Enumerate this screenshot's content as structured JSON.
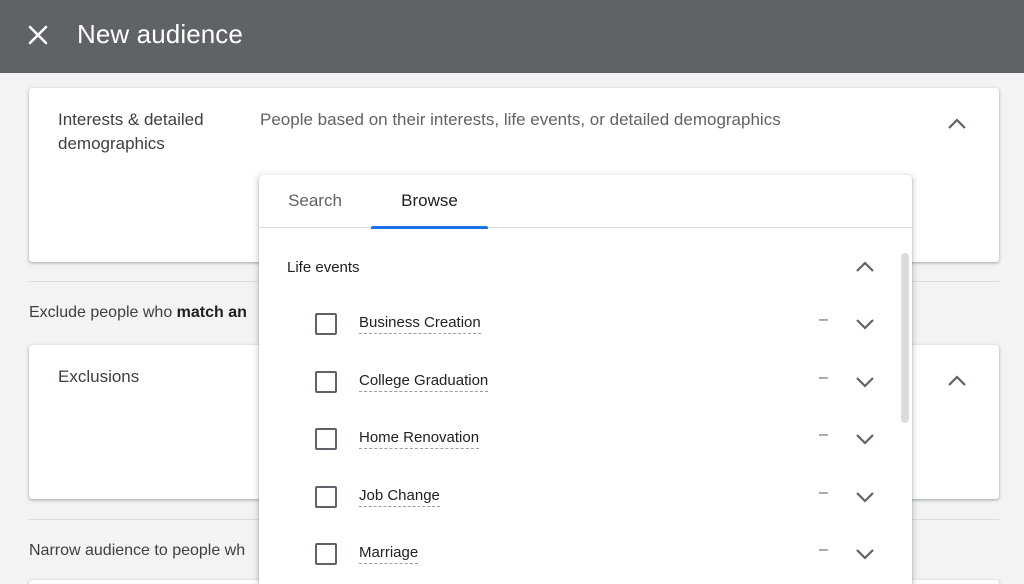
{
  "topbar": {
    "title": "New audience",
    "close_icon": "close-icon",
    "background": "#5f6368"
  },
  "interests_card": {
    "label": "Interests & detailed demographics",
    "description": "People based on their interests, life events, or detailed demographics",
    "toggle_icon": "chevron-up-icon"
  },
  "exclude_section": {
    "text_prefix": "Exclude people who ",
    "text_bold": "match an"
  },
  "exclusions_card": {
    "label": "Exclusions",
    "toggle_icon": "chevron-up-icon"
  },
  "narrow_section": {
    "text": "Narrow audience to people wh"
  },
  "popup": {
    "tabs": [
      {
        "label": "Search",
        "active": false
      },
      {
        "label": "Browse",
        "active": true
      }
    ],
    "accent": "#1a73e8",
    "group": {
      "label": "Life events",
      "toggle_icon": "chevron-up-icon",
      "items": [
        {
          "label": "Business Creation",
          "dash": "–",
          "checked": false
        },
        {
          "label": "College Graduation",
          "dash": "–",
          "checked": false
        },
        {
          "label": "Home Renovation",
          "dash": "–",
          "checked": false
        },
        {
          "label": "Job Change",
          "dash": "–",
          "checked": false
        },
        {
          "label": "Marriage",
          "dash": "–",
          "checked": false
        }
      ]
    }
  }
}
